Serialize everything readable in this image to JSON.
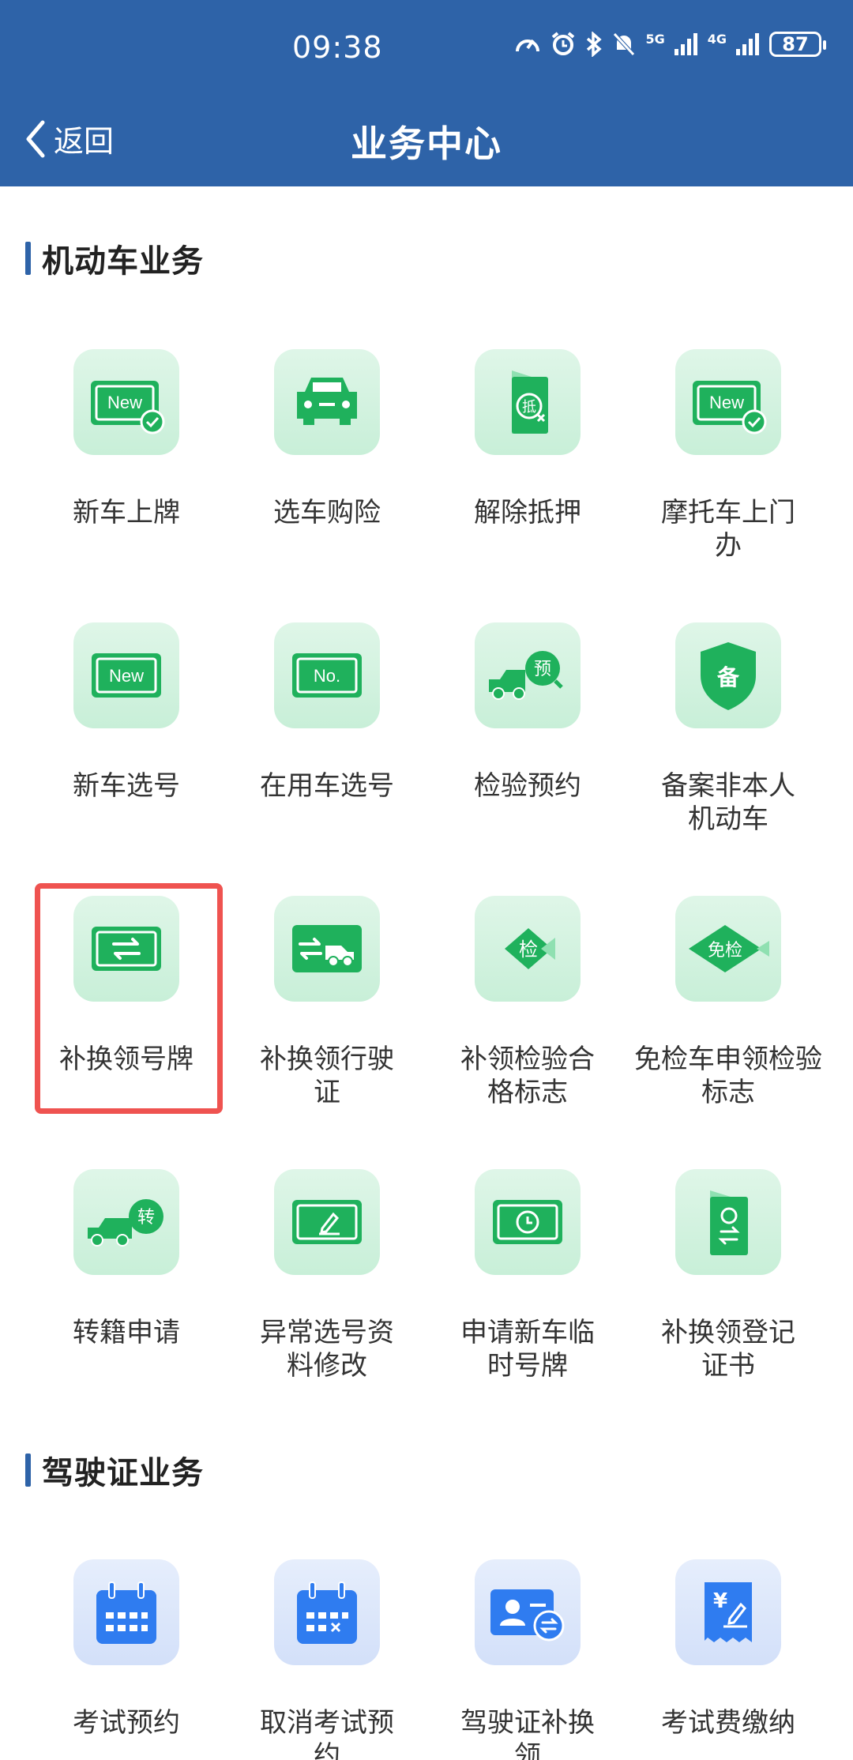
{
  "status_bar": {
    "time": "09:38",
    "battery": "87",
    "signal1": "5G",
    "signal2": "4G"
  },
  "nav": {
    "back_label": "返回",
    "title": "业务中心"
  },
  "sections": [
    {
      "title": "机动车业务",
      "items": [
        {
          "label": "新车上牌",
          "icon": "new-plate-check-icon"
        },
        {
          "label": "选车购险",
          "icon": "car-icon"
        },
        {
          "label": "解除抵押",
          "icon": "mortgage-document-icon"
        },
        {
          "label": "摩托车上门办",
          "icon": "new-plate-check-icon"
        },
        {
          "label": "新车选号",
          "icon": "new-plate-icon"
        },
        {
          "label": "在用车选号",
          "icon": "no-plate-icon"
        },
        {
          "label": "检验预约",
          "icon": "inspection-booking-truck-icon"
        },
        {
          "label": "备案非本人机动车",
          "icon": "shield-icon"
        },
        {
          "label": "补换领号牌",
          "icon": "plate-exchange-icon"
        },
        {
          "label": "补换领行驶证",
          "icon": "license-exchange-truck-icon"
        },
        {
          "label": "补领检验合格标志",
          "icon": "inspection-tag-icon"
        },
        {
          "label": "免检车申领检验标志",
          "icon": "exempt-tag-icon"
        },
        {
          "label": "转籍申请",
          "icon": "transfer-truck-icon"
        },
        {
          "label": "异常选号资料修改",
          "icon": "plate-edit-icon"
        },
        {
          "label": "申请新车临时号牌",
          "icon": "plate-clock-icon"
        },
        {
          "label": "补换领登记证书",
          "icon": "certificate-icon"
        }
      ]
    },
    {
      "title": "驾驶证业务",
      "items": [
        {
          "label": "考试预约",
          "icon": "calendar-icon"
        },
        {
          "label": "取消考试预约",
          "icon": "calendar-cancel-icon"
        },
        {
          "label": "驾驶证补换领",
          "icon": "driver-license-icon"
        },
        {
          "label": "考试费缴纳",
          "icon": "fee-receipt-icon"
        }
      ]
    }
  ],
  "icon_text": {
    "new": "New",
    "no": "No.",
    "di": "抵",
    "yu": "预",
    "bei": "备",
    "jian": "检",
    "mianjian": "免检",
    "zhuan": "转",
    "yen": "¥"
  },
  "colors": {
    "header": "#2e63a8",
    "green": "#1fb15c",
    "blue": "#2f7cf0",
    "highlight": "#ef5350"
  }
}
